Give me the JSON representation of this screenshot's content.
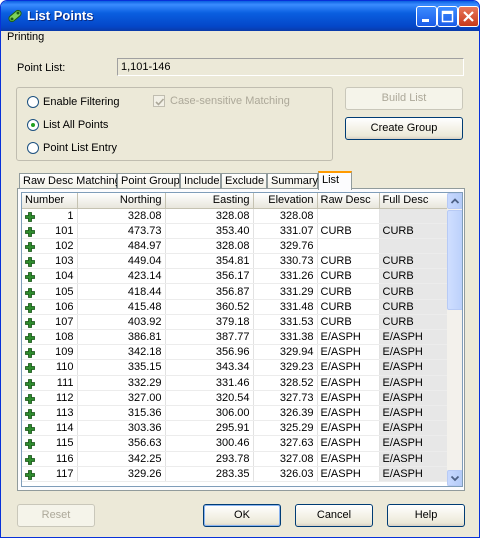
{
  "window": {
    "title": "List Points",
    "icon": "list-points-icon"
  },
  "menu": {
    "printing": "Printing"
  },
  "point_list": {
    "label": "Point List:",
    "value": "1,101-146"
  },
  "options": {
    "enable_filtering": "Enable Filtering",
    "list_all_points": "List All Points",
    "point_list_entry": "Point List Entry",
    "case_sensitive": "Case-sensitive Matching",
    "selected": "list_all_points"
  },
  "buttons": {
    "build_list": "Build List",
    "create_group": "Create Group",
    "reset": "Reset",
    "ok": "OK",
    "cancel": "Cancel",
    "help": "Help"
  },
  "tabs": [
    "Raw Desc Matching",
    "Point Groups",
    "Include",
    "Exclude",
    "Summary",
    "List"
  ],
  "active_tab": "List",
  "table": {
    "columns": [
      "Number",
      "Northing",
      "Easting",
      "Elevation",
      "Raw Desc",
      "Full Desc"
    ],
    "rows": [
      [
        "1",
        "328.08",
        "328.08",
        "328.08",
        "",
        ""
      ],
      [
        "101",
        "473.73",
        "353.40",
        "331.07",
        "CURB",
        "CURB"
      ],
      [
        "102",
        "484.97",
        "328.08",
        "329.76",
        "",
        ""
      ],
      [
        "103",
        "449.04",
        "354.81",
        "330.73",
        "CURB",
        "CURB"
      ],
      [
        "104",
        "423.14",
        "356.17",
        "331.26",
        "CURB",
        "CURB"
      ],
      [
        "105",
        "418.44",
        "356.87",
        "331.29",
        "CURB",
        "CURB"
      ],
      [
        "106",
        "415.48",
        "360.52",
        "331.48",
        "CURB",
        "CURB"
      ],
      [
        "107",
        "403.92",
        "379.18",
        "331.53",
        "CURB",
        "CURB"
      ],
      [
        "108",
        "386.81",
        "387.77",
        "331.38",
        "E/ASPH",
        "E/ASPH"
      ],
      [
        "109",
        "342.18",
        "356.96",
        "329.94",
        "E/ASPH",
        "E/ASPH"
      ],
      [
        "110",
        "335.15",
        "343.34",
        "329.23",
        "E/ASPH",
        "E/ASPH"
      ],
      [
        "111",
        "332.29",
        "331.46",
        "328.52",
        "E/ASPH",
        "E/ASPH"
      ],
      [
        "112",
        "327.00",
        "320.54",
        "327.73",
        "E/ASPH",
        "E/ASPH"
      ],
      [
        "113",
        "315.36",
        "306.00",
        "326.39",
        "E/ASPH",
        "E/ASPH"
      ],
      [
        "114",
        "303.36",
        "295.91",
        "325.29",
        "E/ASPH",
        "E/ASPH"
      ],
      [
        "115",
        "356.63",
        "300.46",
        "327.63",
        "E/ASPH",
        "E/ASPH"
      ],
      [
        "116",
        "342.25",
        "293.78",
        "327.08",
        "E/ASPH",
        "E/ASPH"
      ],
      [
        "117",
        "329.26",
        "283.35",
        "326.03",
        "E/ASPH",
        "E/ASPH"
      ]
    ]
  },
  "colors": {
    "title_blue": "#0a5fe0",
    "point_icon": "#2e8b2e",
    "active_tab_accent": "#ff9a00"
  }
}
